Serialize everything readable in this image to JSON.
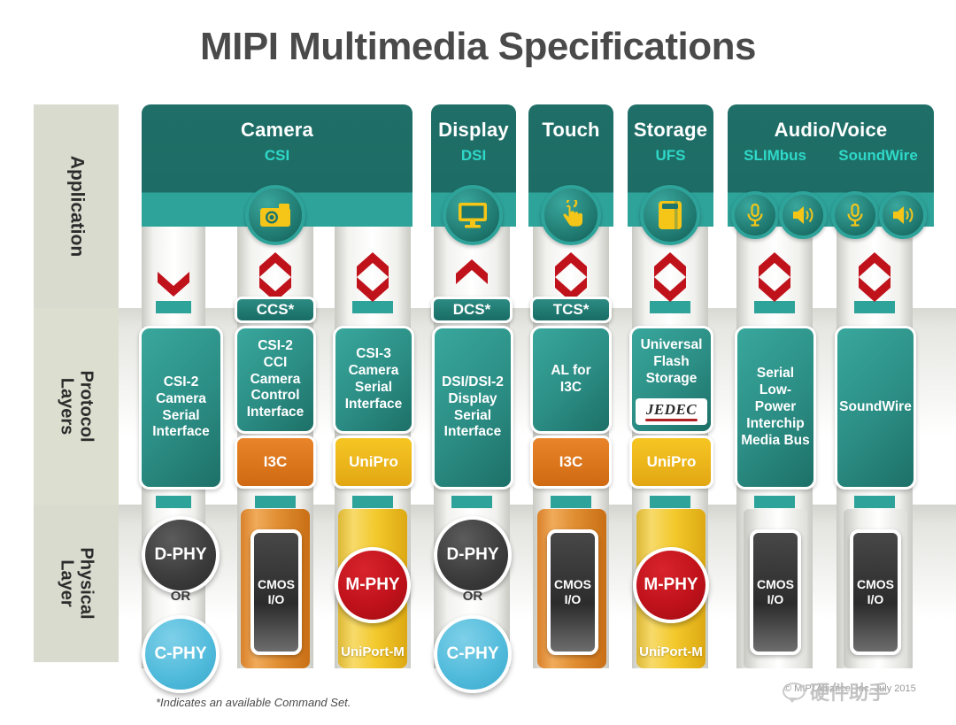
{
  "title": "MIPI Multimedia Specifications",
  "layers": [
    {
      "id": "application",
      "label": "Application"
    },
    {
      "id": "protocol",
      "label": "Protocol\nLayers",
      "line1": "Protocol",
      "line2": "Layers"
    },
    {
      "id": "physical",
      "label": "Physical\nLayer",
      "line1": "Physical",
      "line2": "Layer"
    }
  ],
  "applications": [
    {
      "name": "Camera",
      "spec": "CSI",
      "icons": [
        "camera-icon"
      ]
    },
    {
      "name": "Display",
      "spec": "DSI",
      "icons": [
        "monitor-icon"
      ]
    },
    {
      "name": "Touch",
      "spec": "",
      "icons": [
        "touch-hand-icon"
      ]
    },
    {
      "name": "Storage",
      "spec": "UFS",
      "icons": [
        "storage-icon"
      ]
    },
    {
      "name": "Audio/Voice",
      "specs": [
        "SLIMbus",
        "SoundWire"
      ],
      "icons": [
        "microphone-icon",
        "speaker-icon",
        "microphone-icon",
        "speaker-icon"
      ]
    }
  ],
  "arrows": [
    {
      "column": "csi2",
      "direction": "down"
    },
    {
      "column": "cci",
      "direction": "both"
    },
    {
      "column": "csi3",
      "direction": "both"
    },
    {
      "column": "dsi",
      "direction": "up"
    },
    {
      "column": "touch",
      "direction": "both"
    },
    {
      "column": "storage",
      "direction": "both"
    },
    {
      "column": "slimbus",
      "direction": "both"
    },
    {
      "column": "soundwire",
      "direction": "both"
    }
  ],
  "command_sets": [
    {
      "label": "CCS*",
      "column": "cci"
    },
    {
      "label": "DCS*",
      "column": "dsi"
    },
    {
      "label": "TCS*",
      "column": "touch"
    }
  ],
  "protocol_columns": [
    {
      "id": "csi2",
      "lines": [
        "CSI-2",
        "Camera",
        "Serial",
        "Interface"
      ],
      "sub": null
    },
    {
      "id": "cci",
      "lines": [
        "CSI-2",
        "CCI",
        "Camera",
        "Control",
        "Interface"
      ],
      "sub": {
        "label": "I3C",
        "style": "i3c"
      }
    },
    {
      "id": "csi3",
      "lines": [
        "CSI-3",
        "Camera",
        "Serial",
        "Interface"
      ],
      "sub": {
        "label": "UniPro",
        "style": "unipro"
      }
    },
    {
      "id": "dsi",
      "lines": [
        "DSI/DSI-2",
        "Display",
        "Serial",
        "Interface"
      ],
      "sub": null
    },
    {
      "id": "touch",
      "lines": [
        "AL for",
        "I3C"
      ],
      "sub": {
        "label": "I3C",
        "style": "i3c"
      }
    },
    {
      "id": "storage",
      "lines": [
        "Universal",
        "Flash",
        "Storage"
      ],
      "logo": "JEDEC",
      "sub": {
        "label": "UniPro",
        "style": "unipro"
      }
    },
    {
      "id": "slimbus",
      "lines": [
        "Serial",
        "Low-Power",
        "Interchip",
        "Media Bus"
      ],
      "sub": null
    },
    {
      "id": "soundwire",
      "lines": [
        "SoundWire"
      ],
      "sub": null
    }
  ],
  "physical_columns": [
    {
      "id": "csi2",
      "type": "circles",
      "primary": "D-PHY",
      "connector": "OR",
      "secondary": "C-PHY"
    },
    {
      "id": "cci",
      "type": "cmos",
      "strip": "orange",
      "label_line1": "CMOS",
      "label_line2": "I/O"
    },
    {
      "id": "csi3",
      "type": "mphy",
      "strip": "yellow",
      "circle": "M-PHY",
      "caption": "UniPort-M"
    },
    {
      "id": "dsi",
      "type": "circles",
      "primary": "D-PHY",
      "connector": "OR",
      "secondary": "C-PHY"
    },
    {
      "id": "touch",
      "type": "cmos",
      "strip": "orange",
      "label_line1": "CMOS",
      "label_line2": "I/O"
    },
    {
      "id": "storage",
      "type": "mphy",
      "strip": "yellow",
      "circle": "M-PHY",
      "caption": "UniPort-M"
    },
    {
      "id": "slimbus",
      "type": "cmos",
      "strip": "grey",
      "label_line1": "CMOS",
      "label_line2": "I/O"
    },
    {
      "id": "soundwire",
      "type": "cmos",
      "strip": "grey",
      "label_line1": "CMOS",
      "label_line2": "I/O"
    }
  ],
  "footnote": "*Indicates an available Command Set.",
  "copyright": "© MIPI Alliance, Inc. July 2015",
  "watermark": "硬件助手",
  "colors": {
    "teal_dark": "#1d6c65",
    "teal_mid": "#2b8d84",
    "teal_accent": "#2ea39a",
    "teal_bright": "#2fd8c8",
    "orange": "#d9812b",
    "yellow": "#f3c92c",
    "red": "#c0121b",
    "grey_band": "#d9dbcf",
    "title_grey": "#4a4a4a",
    "cyan_phy": "#53bcdc",
    "dark_phy": "#3d3d3d"
  }
}
